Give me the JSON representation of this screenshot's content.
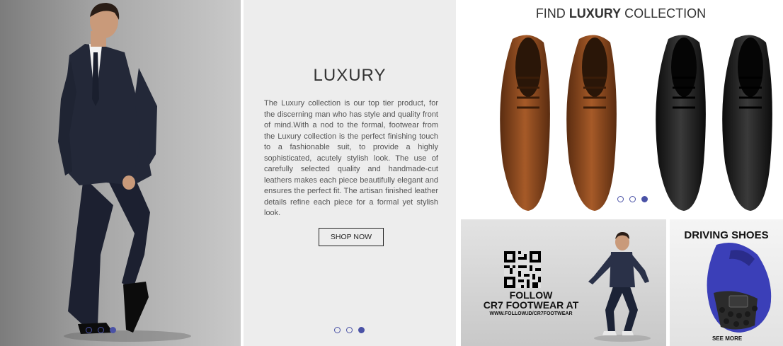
{
  "hero": {
    "dots": [
      false,
      false,
      true
    ]
  },
  "luxury": {
    "title": "LUXURY",
    "body": "The Luxury collection is our top tier product, for the discerning man who has style and quality front of mind.With a nod to the formal, footwear from the Luxury collection is the perfect finishing touch to a fashionable suit, to provide a highly sophisticated, acutely stylish look. The use of carefully selected quality and handmade-cut leathers makes each piece beautifully elegant and ensures the perfect fit. The artisan finished leather details refine each piece for a formal yet stylish look.",
    "button": "SHOP NOW",
    "dots": [
      false,
      false,
      true
    ]
  },
  "collection": {
    "title_pre": "FIND ",
    "title_bold": "LUXURY",
    "title_post": " COLLECTION",
    "dots": [
      false,
      false,
      true
    ],
    "colors": {
      "brown": "#8a4a1f",
      "black": "#1a1a1a"
    }
  },
  "follow": {
    "line1": "FOLLOW",
    "line2": "CR7 FOOTWEAR AT",
    "url": "WWW.FOLLOW.ID/CR7FOOTWEAR"
  },
  "driving": {
    "title": "DRIVING SHOES",
    "link": "SEE MORE",
    "shoe_color": "#3b3fb8"
  },
  "accent": "#4a52a6"
}
